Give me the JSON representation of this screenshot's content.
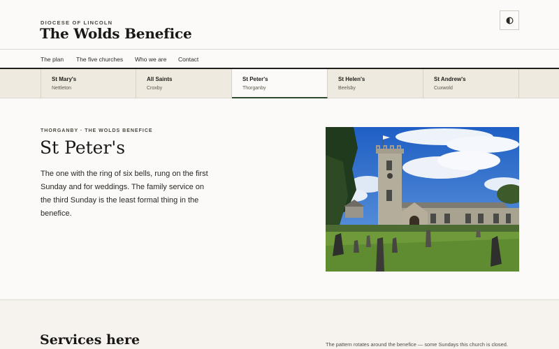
{
  "header": {
    "diocese": "DIOCESE OF LINCOLN",
    "site_title": "The Wolds Benefice",
    "theme_toggle_icon": "contrast-icon"
  },
  "nav": {
    "items": [
      {
        "label": "The plan"
      },
      {
        "label": "The five churches"
      },
      {
        "label": "Who we are"
      },
      {
        "label": "Contact"
      }
    ]
  },
  "tabs": [
    {
      "name": "St Mary's",
      "place": "Nettleton"
    },
    {
      "name": "All Saints",
      "place": "Croxby"
    },
    {
      "name": "St Peter's",
      "place": "Thorganby",
      "active": true
    },
    {
      "name": "St Helen's",
      "place": "Beelsby"
    },
    {
      "name": "St Andrew's",
      "place": "Cuxwold"
    }
  ],
  "church": {
    "eyebrow": "THORGANBY · THE WOLDS BENEFICE",
    "title": "St Peter's",
    "intro": "The one with the ring of six bells, rung on the first Sunday and for weddings. The family service on the third Sunday is the least formal thing in the benefice."
  },
  "services": {
    "title": "Services here",
    "note": "The pattern rotates around the benefice — some Sundays this church is closed."
  },
  "colors": {
    "background": "#fcfaf8",
    "tab_bar": "#efeae0",
    "active_underline": "#2d4a2f",
    "text": "#1f1d1a"
  }
}
